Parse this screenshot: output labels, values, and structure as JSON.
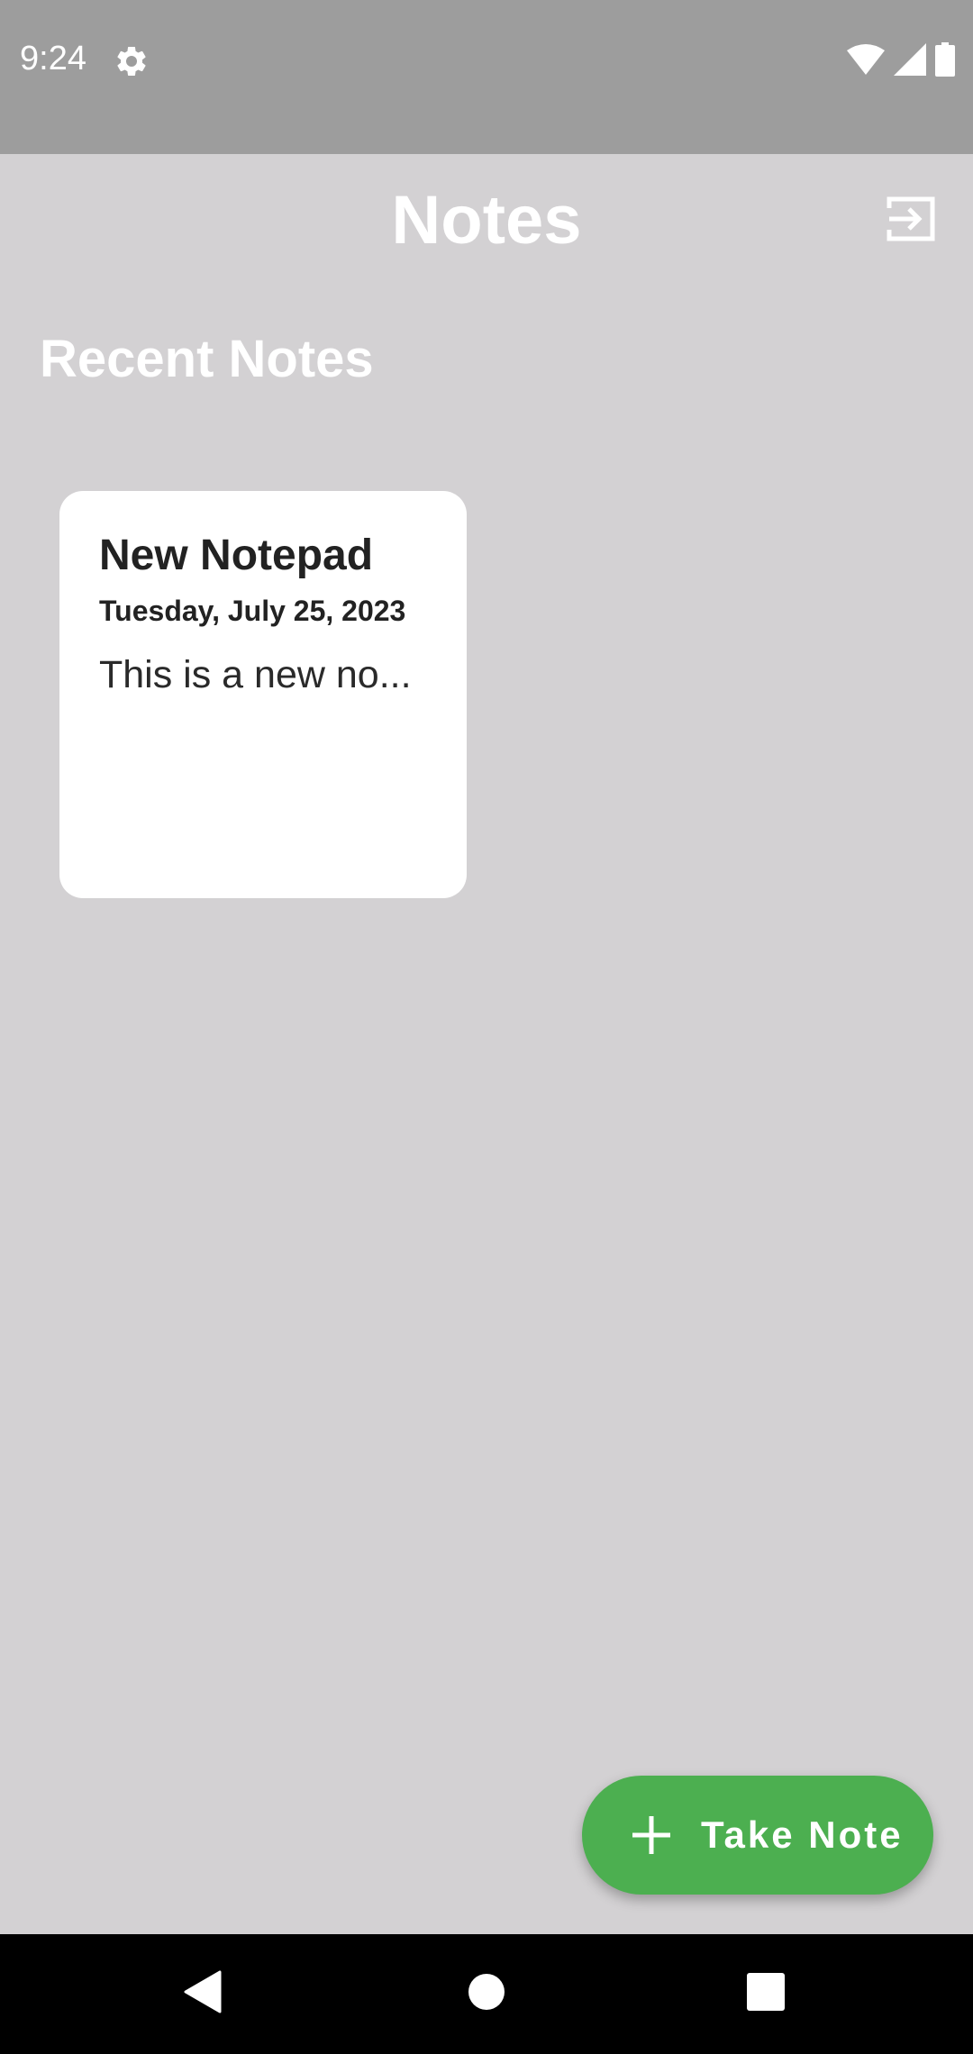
{
  "status_bar": {
    "time": "9:24",
    "icons": [
      "settings-icon",
      "wifi-icon",
      "cell-signal-icon",
      "battery-icon"
    ]
  },
  "app_bar": {
    "title": "Notes",
    "action_icon": "logout-icon"
  },
  "section": {
    "title": "Recent Notes"
  },
  "notes": [
    {
      "title": "New Notepad",
      "date": "Tuesday, July 25, 2023",
      "preview": "This is a new no..."
    }
  ],
  "fab": {
    "label": "Take Note",
    "icon": "plus-icon"
  },
  "nav_bar": {
    "icons": [
      "back-icon",
      "home-icon",
      "recents-icon"
    ]
  },
  "colors": {
    "background": "#d3d1d3",
    "status_bar": "#9d9d9d",
    "card": "#ffffff",
    "fab": "#4caf50",
    "nav_bar": "#000000"
  }
}
